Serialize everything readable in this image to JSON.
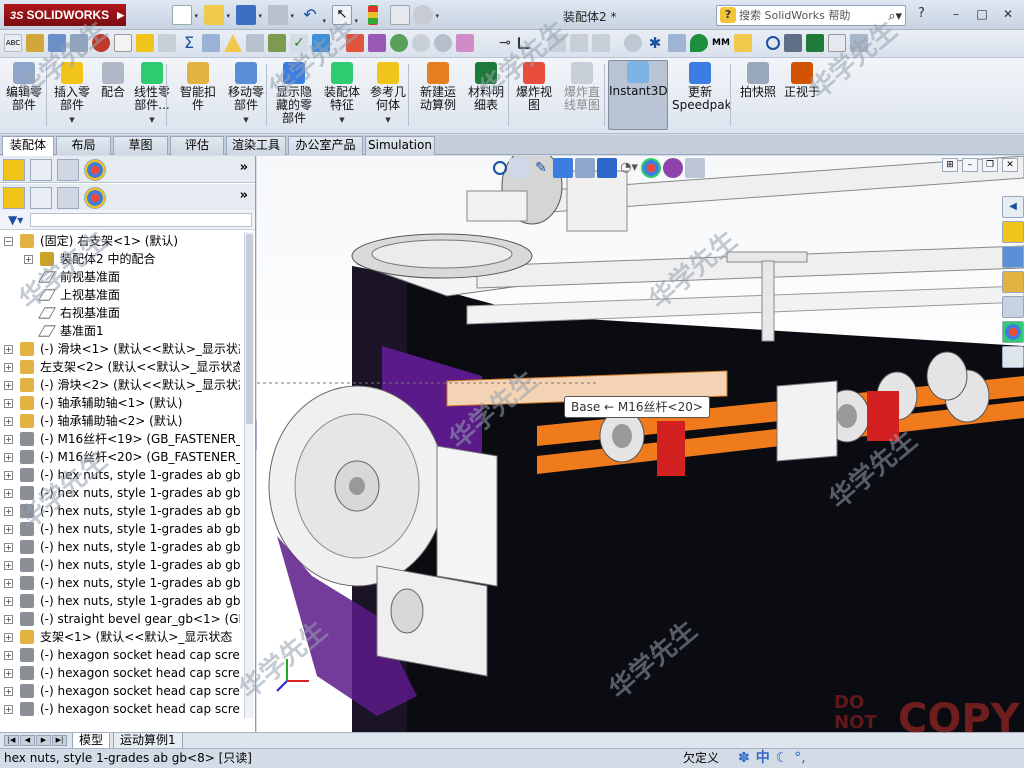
{
  "app": {
    "logo_text": "SOLIDWORKS",
    "logo_prefix": "3S",
    "document_title": "装配体2 *",
    "search_placeholder": "搜索 SolidWorks 帮助",
    "window_controls": [
      "–",
      "□",
      "✕"
    ],
    "help_glyph": "?"
  },
  "colors": {
    "accent": "#1b4fa0",
    "logo_red": "#a4161a",
    "orange_rod": "#f07b1d",
    "purple_plate": "#5a1a8a",
    "machine_dark": "#0b0b12"
  },
  "command_manager": [
    {
      "label": "编辑零部件",
      "icon": "edit-component-icon",
      "dropdown": false,
      "state": "normal"
    },
    {
      "label": "插入零部件",
      "icon": "insert-component-icon",
      "dropdown": true,
      "state": "normal"
    },
    {
      "label": "配合",
      "icon": "mate-icon",
      "dropdown": false,
      "state": "normal"
    },
    {
      "label": "线性零部件...",
      "icon": "linear-pattern-icon",
      "dropdown": true,
      "state": "normal"
    },
    {
      "label": "智能扣件",
      "icon": "smart-fasteners-icon",
      "dropdown": false,
      "state": "normal"
    },
    {
      "label": "移动零部件",
      "icon": "move-component-icon",
      "dropdown": true,
      "state": "normal"
    },
    {
      "label": "显示隐藏的零部件",
      "icon": "show-hidden-icon",
      "dropdown": false,
      "state": "normal"
    },
    {
      "label": "装配体特征",
      "icon": "assembly-features-icon",
      "dropdown": true,
      "state": "normal"
    },
    {
      "label": "参考几何体",
      "icon": "reference-geometry-icon",
      "dropdown": true,
      "state": "normal"
    },
    {
      "label": "新建运动算例",
      "icon": "new-motion-study-icon",
      "dropdown": false,
      "state": "normal"
    },
    {
      "label": "材料明细表",
      "icon": "bom-icon",
      "dropdown": false,
      "state": "normal"
    },
    {
      "label": "爆炸视图",
      "icon": "exploded-view-icon",
      "dropdown": false,
      "state": "normal"
    },
    {
      "label": "爆炸直线草图",
      "icon": "explode-line-sketch-icon",
      "dropdown": false,
      "state": "grey"
    },
    {
      "label": "Instant3D",
      "icon": "instant3d-icon",
      "dropdown": false,
      "state": "active"
    },
    {
      "label": "更新Speedpak",
      "icon": "speedpak-icon",
      "dropdown": false,
      "state": "normal"
    },
    {
      "label": "拍快照",
      "icon": "snapshot-icon",
      "dropdown": false,
      "state": "normal"
    },
    {
      "label": "正视于",
      "icon": "normal-to-icon",
      "dropdown": false,
      "state": "normal"
    }
  ],
  "tabs": [
    {
      "label": "装配体",
      "active": true
    },
    {
      "label": "布局",
      "active": false
    },
    {
      "label": "草图",
      "active": false
    },
    {
      "label": "评估",
      "active": false
    },
    {
      "label": "渲染工具",
      "active": false
    },
    {
      "label": "办公室产品",
      "active": false
    },
    {
      "label": "Simulation",
      "active": false
    }
  ],
  "left_panel": {
    "chevron": "»",
    "tree": [
      {
        "pm": "−",
        "icon": "assembly-icon",
        "text": "(固定) 右支架<1> (默认)"
      },
      {
        "pm": "+",
        "icon": "mates-icon",
        "text": "装配体2 中的配合",
        "indent": 1
      },
      {
        "pm": "",
        "icon": "plane-icon",
        "text": "前视基准面",
        "indent": 1
      },
      {
        "pm": "",
        "icon": "plane-icon",
        "text": "上视基准面",
        "indent": 1
      },
      {
        "pm": "",
        "icon": "plane-icon",
        "text": "右视基准面",
        "indent": 1
      },
      {
        "pm": "",
        "icon": "plane-icon",
        "text": "基准面1",
        "indent": 1
      },
      {
        "pm": "+",
        "icon": "assembly-icon",
        "text": "(-) 滑块<1> (默认<<默认>_显示状态"
      },
      {
        "pm": "+",
        "icon": "assembly-icon",
        "text": "左支架<2> (默认<<默认>_显示状态"
      },
      {
        "pm": "+",
        "icon": "assembly-icon",
        "text": "(-) 滑块<2> (默认<<默认>_显示状态"
      },
      {
        "pm": "+",
        "icon": "part-icon",
        "text": "(-) 轴承辅助轴<1> (默认)"
      },
      {
        "pm": "+",
        "icon": "part-icon",
        "text": "(-) 轴承辅助轴<2> (默认)"
      },
      {
        "pm": "+",
        "icon": "fastener-icon",
        "text": "(-) M16丝杆<19> (GB_FASTENER_B"
      },
      {
        "pm": "+",
        "icon": "fastener-icon",
        "text": "(-) M16丝杆<20> (GB_FASTENER_B"
      },
      {
        "pm": "+",
        "icon": "fastener-icon",
        "text": "(-) hex nuts, style 1-grades ab gb"
      },
      {
        "pm": "+",
        "icon": "fastener-icon",
        "text": "(-) hex nuts, style 1-grades ab gb"
      },
      {
        "pm": "+",
        "icon": "fastener-icon",
        "text": "(-) hex nuts, style 1-grades ab gb"
      },
      {
        "pm": "+",
        "icon": "fastener-icon",
        "text": "(-) hex nuts, style 1-grades ab gb"
      },
      {
        "pm": "+",
        "icon": "fastener-icon",
        "text": "(-) hex nuts, style 1-grades ab gb"
      },
      {
        "pm": "+",
        "icon": "fastener-icon",
        "text": "(-) hex nuts, style 1-grades ab gb"
      },
      {
        "pm": "+",
        "icon": "fastener-icon",
        "text": "(-) hex nuts, style 1-grades ab gb"
      },
      {
        "pm": "+",
        "icon": "fastener-icon",
        "text": "(-) hex nuts, style 1-grades ab gb"
      },
      {
        "pm": "+",
        "icon": "fastener-icon",
        "text": "(-) straight bevel gear_gb<1> (GB"
      },
      {
        "pm": "+",
        "icon": "assembly-icon",
        "text": "支架<1> (默认<<默认>_显示状态"
      },
      {
        "pm": "+",
        "icon": "fastener-icon",
        "text": "(-) hexagon socket head cap screw"
      },
      {
        "pm": "+",
        "icon": "fastener-icon",
        "text": "(-) hexagon socket head cap screw"
      },
      {
        "pm": "+",
        "icon": "fastener-icon",
        "text": "(-) hexagon socket head cap screw"
      },
      {
        "pm": "+",
        "icon": "fastener-icon",
        "text": "(-) hexagon socket head cap screw"
      }
    ]
  },
  "viewport": {
    "tooltip": "Base ← M16丝杆<20>"
  },
  "bottom_tabs": [
    {
      "label": "模型",
      "active": true
    },
    {
      "label": "运动算例1",
      "active": false
    }
  ],
  "statusbar": {
    "selection": "hex nuts, style 1-grades ab gb<8> [只读]",
    "state": "欠定义",
    "ime_zh": "中"
  },
  "watermarks": {
    "text": "华学先生",
    "stamp_line1": "DO",
    "stamp_line2": "NOT",
    "stamp_line3": "COPY"
  }
}
